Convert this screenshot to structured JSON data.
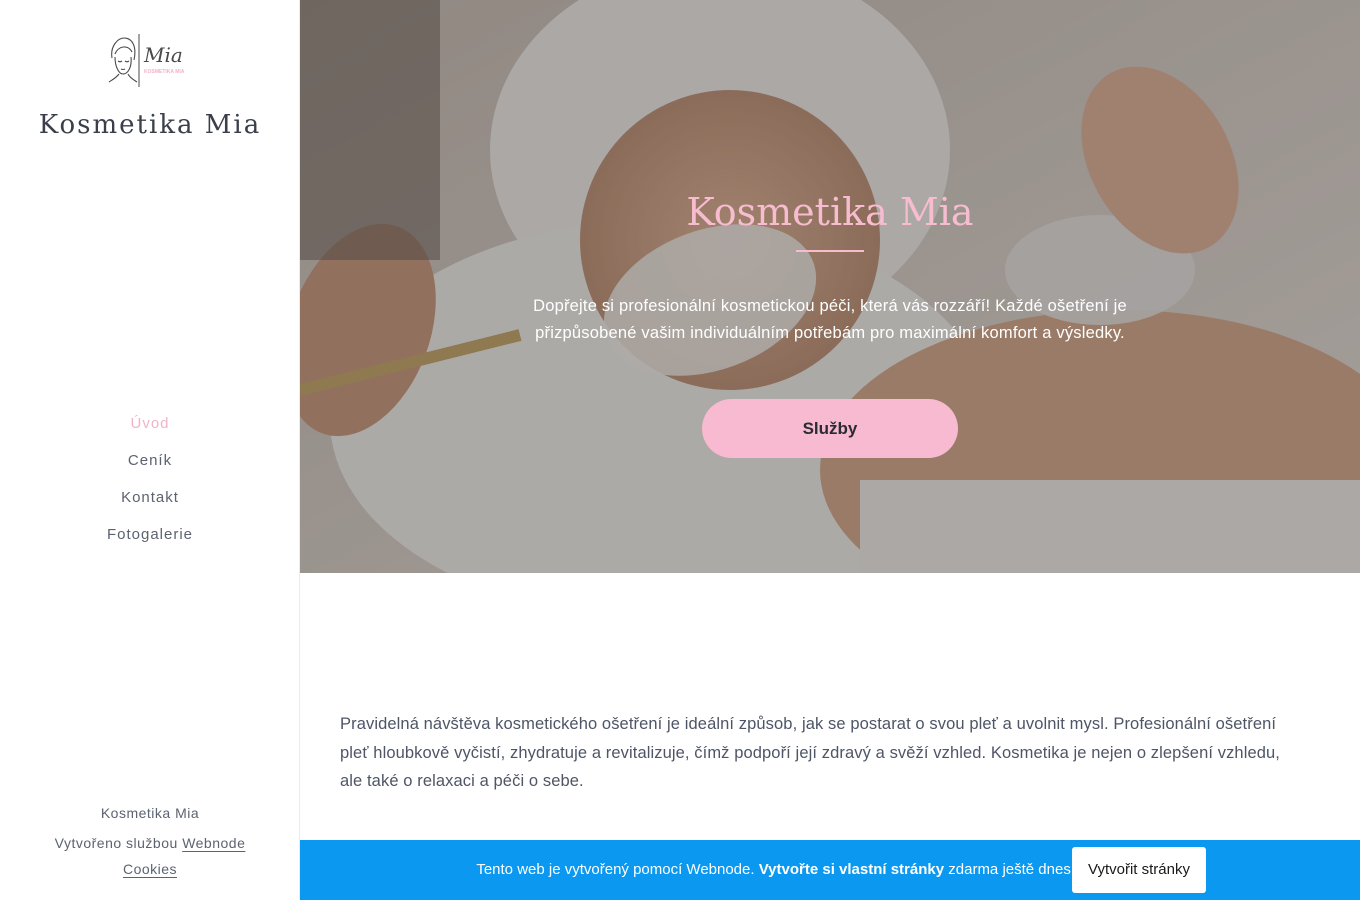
{
  "sidebar": {
    "logo": {
      "script_text": "Mia",
      "small_text": "KOSMETIKA MIA",
      "accent": "#f2b3c6"
    },
    "site_title": "Kosmetika Mia",
    "nav": [
      {
        "label": "Úvod",
        "active": true
      },
      {
        "label": "Ceník",
        "active": false
      },
      {
        "label": "Kontakt",
        "active": false
      },
      {
        "label": "Fotogalerie",
        "active": false
      }
    ],
    "footer": {
      "name": "Kosmetika Mia",
      "created_prefix": "Vytvořeno službou",
      "created_link": "Webnode",
      "cookies_link": "Cookies"
    }
  },
  "hero": {
    "title": "Kosmetika Mia",
    "text": "Dopřejte si profesionální kosmetickou péči, která vás rozzáří! Každé ošetření je přizpůsobené vašim individuálním potřebám pro maximální komfort a výsledky.",
    "button_label": "Služby",
    "accent": "#f7bad0"
  },
  "content": {
    "paragraph": "Pravidelná návštěva kosmetického ošetření je ideální způsob, jak se postarat o svou pleť a uvolnit mysl. Profesionální ošetření pleť hloubkově vyčistí, zhydratuje a revitalizuje, čímž podpoří její zdravý a svěží vzhled. Kosmetika je nejen o zlepšení vzhledu, ale také o relaxaci a péči o sebe."
  },
  "promo_bar": {
    "text_before": "Tento web je vytvořený pomocí Webnode. ",
    "text_bold": "Vytvořte si vlastní stránky",
    "text_after": " zdarma ještě dnes!",
    "button_label": "Vytvořit stránky",
    "color": "#0a98f0"
  }
}
